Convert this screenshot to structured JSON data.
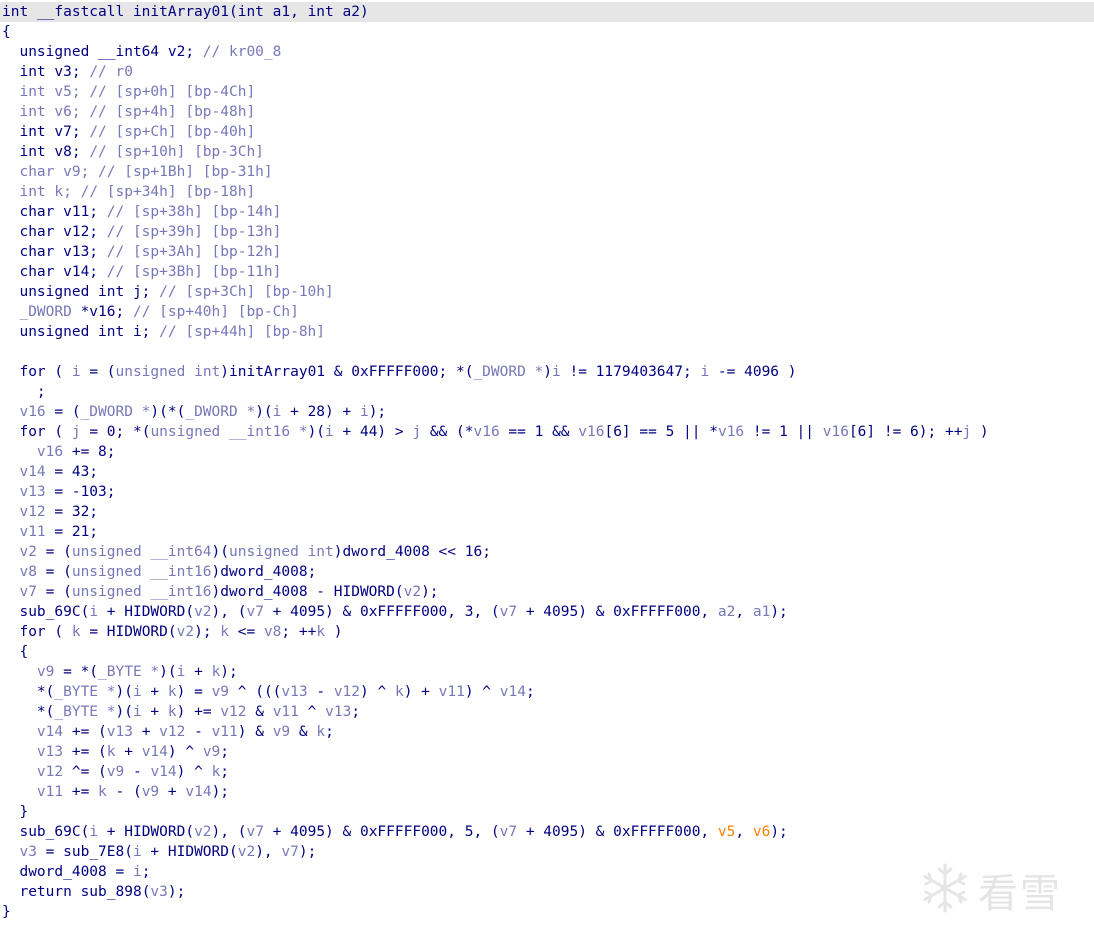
{
  "watermark": {
    "text": "看雪",
    "icon": "snowflake-icon"
  },
  "colors": {
    "code": "#000080",
    "type": "#7878b8",
    "variable": "#7878b8",
    "comment": "#8c8c8c",
    "arg_unused": "#ff8000",
    "highlight_line": "#e6e6e6"
  },
  "lines": [
    [
      [
        "kw",
        "int __fastcall "
      ],
      [
        "f",
        "initArray01"
      ],
      [
        "p",
        "("
      ],
      [
        "kw",
        "int "
      ],
      [
        "n",
        "a1, "
      ],
      [
        "kw",
        "int "
      ],
      [
        "n",
        "a2)"
      ]
    ],
    [
      [
        "p",
        "{"
      ]
    ],
    [
      [
        "kw",
        "  unsigned __int64 "
      ],
      [
        "n",
        "v2; "
      ],
      [
        "c",
        "// kr00_8"
      ]
    ],
    [
      [
        "kw",
        "  int "
      ],
      [
        "n",
        "v3; "
      ],
      [
        "c",
        "// r0"
      ]
    ],
    [
      [
        "t",
        "  int "
      ],
      [
        "v",
        "v5; "
      ],
      [
        "c",
        "// [sp+0h] [bp-4Ch]"
      ]
    ],
    [
      [
        "t",
        "  int "
      ],
      [
        "v",
        "v6; "
      ],
      [
        "c",
        "// [sp+4h] [bp-48h]"
      ]
    ],
    [
      [
        "kw",
        "  int "
      ],
      [
        "n",
        "v7; "
      ],
      [
        "c",
        "// [sp+Ch] [bp-40h]"
      ]
    ],
    [
      [
        "kw",
        "  int "
      ],
      [
        "n",
        "v8; "
      ],
      [
        "c",
        "// [sp+10h] [bp-3Ch]"
      ]
    ],
    [
      [
        "t",
        "  char "
      ],
      [
        "v",
        "v9; "
      ],
      [
        "c",
        "// [sp+1Bh] [bp-31h]"
      ]
    ],
    [
      [
        "t",
        "  int "
      ],
      [
        "v",
        "k; "
      ],
      [
        "c",
        "// [sp+34h] [bp-18h]"
      ]
    ],
    [
      [
        "kw",
        "  char "
      ],
      [
        "n",
        "v11; "
      ],
      [
        "c",
        "// [sp+38h] [bp-14h]"
      ]
    ],
    [
      [
        "kw",
        "  char "
      ],
      [
        "n",
        "v12; "
      ],
      [
        "c",
        "// [sp+39h] [bp-13h]"
      ]
    ],
    [
      [
        "kw",
        "  char "
      ],
      [
        "n",
        "v13; "
      ],
      [
        "c",
        "// [sp+3Ah] [bp-12h]"
      ]
    ],
    [
      [
        "kw",
        "  char "
      ],
      [
        "n",
        "v14; "
      ],
      [
        "c",
        "// [sp+3Bh] [bp-11h]"
      ]
    ],
    [
      [
        "kw",
        "  unsigned int "
      ],
      [
        "n",
        "j; "
      ],
      [
        "c",
        "// [sp+3Ch] [bp-10h]"
      ]
    ],
    [
      [
        "t",
        "  _DWORD "
      ],
      [
        "n",
        "*v16; "
      ],
      [
        "c",
        "// [sp+40h] [bp-Ch]"
      ]
    ],
    [
      [
        "kw",
        "  unsigned int "
      ],
      [
        "n",
        "i; "
      ],
      [
        "c",
        "// [sp+44h] [bp-8h]"
      ]
    ],
    [
      [
        "p",
        ""
      ]
    ],
    [
      [
        "kw",
        "  for "
      ],
      [
        "p",
        "( "
      ],
      [
        "v",
        "i"
      ],
      [
        "p",
        " = ("
      ],
      [
        "t",
        "unsigned int"
      ],
      [
        "p",
        ")"
      ],
      [
        "g",
        "initArray01"
      ],
      [
        "p",
        " & 0xFFFFF000; *("
      ],
      [
        "t",
        "_DWORD *"
      ],
      [
        "p",
        ")"
      ],
      [
        "v",
        "i"
      ],
      [
        "p",
        " != 1179403647; "
      ],
      [
        "v",
        "i"
      ],
      [
        "p",
        " -= 4096 )"
      ]
    ],
    [
      [
        "p",
        "    ;"
      ]
    ],
    [
      [
        "v",
        "  v16"
      ],
      [
        "p",
        " = ("
      ],
      [
        "t",
        "_DWORD *"
      ],
      [
        "p",
        ")(*("
      ],
      [
        "t",
        "_DWORD *"
      ],
      [
        "p",
        ")("
      ],
      [
        "v",
        "i"
      ],
      [
        "p",
        " + 28) + "
      ],
      [
        "v",
        "i"
      ],
      [
        "p",
        ");"
      ]
    ],
    [
      [
        "kw",
        "  for "
      ],
      [
        "p",
        "( "
      ],
      [
        "v",
        "j"
      ],
      [
        "p",
        " = 0; *("
      ],
      [
        "t",
        "unsigned __int16 *"
      ],
      [
        "p",
        ")("
      ],
      [
        "v",
        "i"
      ],
      [
        "p",
        " + 44) > "
      ],
      [
        "v",
        "j"
      ],
      [
        "p",
        " && (*"
      ],
      [
        "v",
        "v16"
      ],
      [
        "p",
        " == 1 && "
      ],
      [
        "v",
        "v16"
      ],
      [
        "p",
        "[6] == 5 || *"
      ],
      [
        "v",
        "v16"
      ],
      [
        "p",
        " != 1 || "
      ],
      [
        "v",
        "v16"
      ],
      [
        "p",
        "[6] != 6); ++"
      ],
      [
        "v",
        "j"
      ],
      [
        "p",
        " )"
      ]
    ],
    [
      [
        "v",
        "    v16"
      ],
      [
        "p",
        " += 8;"
      ]
    ],
    [
      [
        "v",
        "  v14"
      ],
      [
        "p",
        " = 43;"
      ]
    ],
    [
      [
        "v",
        "  v13"
      ],
      [
        "p",
        " = -103;"
      ]
    ],
    [
      [
        "v",
        "  v12"
      ],
      [
        "p",
        " = 32;"
      ]
    ],
    [
      [
        "v",
        "  v11"
      ],
      [
        "p",
        " = 21;"
      ]
    ],
    [
      [
        "v",
        "  v2"
      ],
      [
        "p",
        " = ("
      ],
      [
        "t",
        "unsigned __int64"
      ],
      [
        "p",
        ")("
      ],
      [
        "t",
        "unsigned int"
      ],
      [
        "p",
        ")"
      ],
      [
        "g",
        "dword_4008"
      ],
      [
        "p",
        " << 16;"
      ]
    ],
    [
      [
        "v",
        "  v8"
      ],
      [
        "p",
        " = ("
      ],
      [
        "t",
        "unsigned __int16"
      ],
      [
        "p",
        ")"
      ],
      [
        "g",
        "dword_4008"
      ],
      [
        "p",
        ";"
      ]
    ],
    [
      [
        "v",
        "  v7"
      ],
      [
        "p",
        " = ("
      ],
      [
        "t",
        "unsigned __int16"
      ],
      [
        "p",
        ")"
      ],
      [
        "g",
        "dword_4008"
      ],
      [
        "p",
        " - HIDWORD("
      ],
      [
        "v",
        "v2"
      ],
      [
        "p",
        ");"
      ]
    ],
    [
      [
        "f",
        "  sub_69C"
      ],
      [
        "p",
        "("
      ],
      [
        "v",
        "i"
      ],
      [
        "p",
        " + HIDWORD("
      ],
      [
        "v",
        "v2"
      ],
      [
        "p",
        "), ("
      ],
      [
        "v",
        "v7"
      ],
      [
        "p",
        " + 4095) & 0xFFFFF000, 3, ("
      ],
      [
        "v",
        "v7"
      ],
      [
        "p",
        " + 4095) & 0xFFFFF000, "
      ],
      [
        "v",
        "a2"
      ],
      [
        "p",
        ", "
      ],
      [
        "v",
        "a1"
      ],
      [
        "p",
        ");"
      ]
    ],
    [
      [
        "kw",
        "  for "
      ],
      [
        "p",
        "( "
      ],
      [
        "v",
        "k"
      ],
      [
        "p",
        " = HIDWORD("
      ],
      [
        "v",
        "v2"
      ],
      [
        "p",
        "); "
      ],
      [
        "v",
        "k"
      ],
      [
        "p",
        " <= "
      ],
      [
        "v",
        "v8"
      ],
      [
        "p",
        "; ++"
      ],
      [
        "v",
        "k"
      ],
      [
        "p",
        " )"
      ]
    ],
    [
      [
        "p",
        "  {"
      ]
    ],
    [
      [
        "v",
        "    v9"
      ],
      [
        "p",
        " = *("
      ],
      [
        "t",
        "_BYTE *"
      ],
      [
        "p",
        ")("
      ],
      [
        "v",
        "i"
      ],
      [
        "p",
        " + "
      ],
      [
        "v",
        "k"
      ],
      [
        "p",
        ");"
      ]
    ],
    [
      [
        "p",
        "    *("
      ],
      [
        "t",
        "_BYTE *"
      ],
      [
        "p",
        ")("
      ],
      [
        "v",
        "i"
      ],
      [
        "p",
        " + "
      ],
      [
        "v",
        "k"
      ],
      [
        "p",
        ") = "
      ],
      [
        "v",
        "v9"
      ],
      [
        "p",
        " ^ ((("
      ],
      [
        "v",
        "v13"
      ],
      [
        "p",
        " - "
      ],
      [
        "v",
        "v12"
      ],
      [
        "p",
        ") ^ "
      ],
      [
        "v",
        "k"
      ],
      [
        "p",
        ") + "
      ],
      [
        "v",
        "v11"
      ],
      [
        "p",
        ") ^ "
      ],
      [
        "v",
        "v14"
      ],
      [
        "p",
        ";"
      ]
    ],
    [
      [
        "p",
        "    *("
      ],
      [
        "t",
        "_BYTE *"
      ],
      [
        "p",
        ")("
      ],
      [
        "v",
        "i"
      ],
      [
        "p",
        " + "
      ],
      [
        "v",
        "k"
      ],
      [
        "p",
        ") += "
      ],
      [
        "v",
        "v12"
      ],
      [
        "p",
        " & "
      ],
      [
        "v",
        "v11"
      ],
      [
        "p",
        " ^ "
      ],
      [
        "v",
        "v13"
      ],
      [
        "p",
        ";"
      ]
    ],
    [
      [
        "v",
        "    v14"
      ],
      [
        "p",
        " += ("
      ],
      [
        "v",
        "v13"
      ],
      [
        "p",
        " + "
      ],
      [
        "v",
        "v12"
      ],
      [
        "p",
        " - "
      ],
      [
        "v",
        "v11"
      ],
      [
        "p",
        ") & "
      ],
      [
        "v",
        "v9"
      ],
      [
        "p",
        " & "
      ],
      [
        "v",
        "k"
      ],
      [
        "p",
        ";"
      ]
    ],
    [
      [
        "v",
        "    v13"
      ],
      [
        "p",
        " += ("
      ],
      [
        "v",
        "k"
      ],
      [
        "p",
        " + "
      ],
      [
        "v",
        "v14"
      ],
      [
        "p",
        ") ^ "
      ],
      [
        "v",
        "v9"
      ],
      [
        "p",
        ";"
      ]
    ],
    [
      [
        "v",
        "    v12"
      ],
      [
        "p",
        " ^= ("
      ],
      [
        "v",
        "v9"
      ],
      [
        "p",
        " - "
      ],
      [
        "v",
        "v14"
      ],
      [
        "p",
        ") ^ "
      ],
      [
        "v",
        "k"
      ],
      [
        "p",
        ";"
      ]
    ],
    [
      [
        "v",
        "    v11"
      ],
      [
        "p",
        " += "
      ],
      [
        "v",
        "k"
      ],
      [
        "p",
        " - ("
      ],
      [
        "v",
        "v9"
      ],
      [
        "p",
        " + "
      ],
      [
        "v",
        "v14"
      ],
      [
        "p",
        ");"
      ]
    ],
    [
      [
        "p",
        "  }"
      ]
    ],
    [
      [
        "f",
        "  sub_69C"
      ],
      [
        "p",
        "("
      ],
      [
        "v",
        "i"
      ],
      [
        "p",
        " + HIDWORD("
      ],
      [
        "v",
        "v2"
      ],
      [
        "p",
        "), ("
      ],
      [
        "v",
        "v7"
      ],
      [
        "p",
        " + 4095) & 0xFFFFF000, 5, ("
      ],
      [
        "v",
        "v7"
      ],
      [
        "p",
        " + 4095) & 0xFFFFF000, "
      ],
      [
        "a",
        "v5"
      ],
      [
        "p",
        ", "
      ],
      [
        "a",
        "v6"
      ],
      [
        "p",
        ");"
      ]
    ],
    [
      [
        "v",
        "  v3"
      ],
      [
        "p",
        " = "
      ],
      [
        "f",
        "sub_7E8"
      ],
      [
        "p",
        "("
      ],
      [
        "v",
        "i"
      ],
      [
        "p",
        " + HIDWORD("
      ],
      [
        "v",
        "v2"
      ],
      [
        "p",
        "), "
      ],
      [
        "v",
        "v7"
      ],
      [
        "p",
        ");"
      ]
    ],
    [
      [
        "g",
        "  dword_4008"
      ],
      [
        "p",
        " = "
      ],
      [
        "v",
        "i"
      ],
      [
        "p",
        ";"
      ]
    ],
    [
      [
        "kw",
        "  return "
      ],
      [
        "f",
        "sub_898"
      ],
      [
        "p",
        "("
      ],
      [
        "v",
        "v3"
      ],
      [
        "p",
        ");"
      ]
    ],
    [
      [
        "p",
        "}"
      ]
    ]
  ]
}
